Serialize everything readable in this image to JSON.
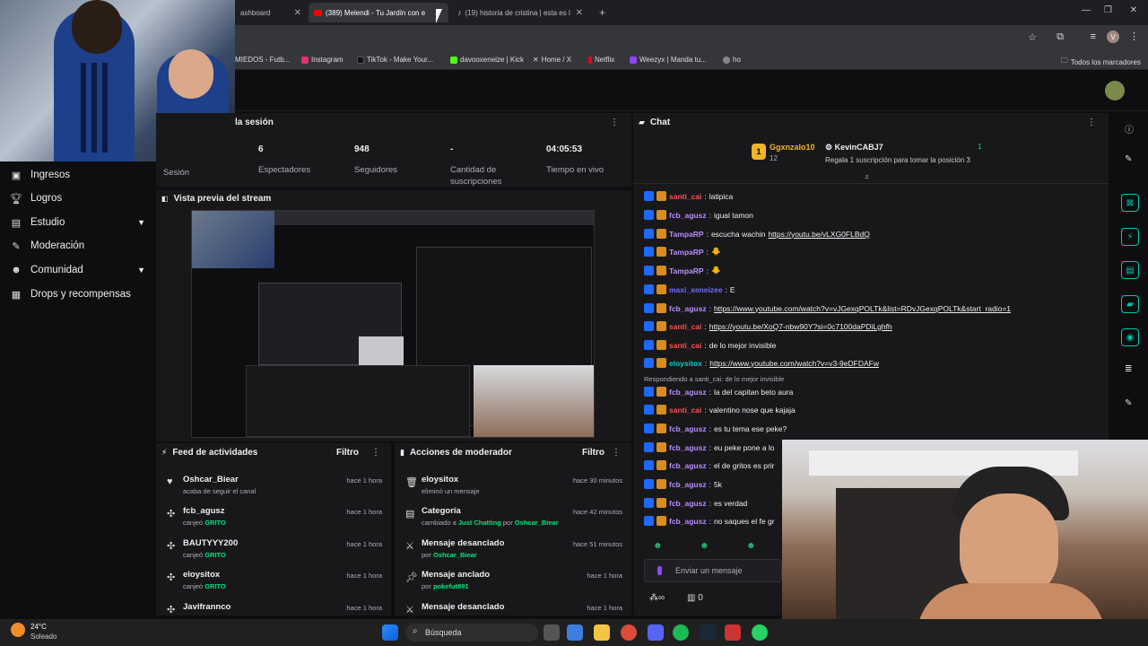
{
  "browser": {
    "tabs": [
      {
        "label": "ashboard",
        "active": false
      },
      {
        "label": "(389) Melendi - Tu Jardín con e",
        "active": true
      },
      {
        "label": "(19) historia de cristina | esta es l",
        "active": false
      }
    ],
    "new_tab": "+",
    "bookmarks": [
      {
        "label": "MIEDOS - Futb...",
        "icon_color": "#3f3f46"
      },
      {
        "label": "Instagram",
        "icon_color": "#e1306c"
      },
      {
        "label": "TikTok - Make Your...",
        "icon_color": "#000000"
      },
      {
        "label": "davooxeneize | Kick",
        "icon_color": "#53fc18"
      },
      {
        "label": "Home / X",
        "icon_color": "#000000"
      },
      {
        "label": "Netflix",
        "icon_color": "#e50914"
      },
      {
        "label": "Weezyx | Manda tu...",
        "icon_color": "#9146ff"
      },
      {
        "label": "ho",
        "icon_color": "#888888"
      }
    ],
    "all_bookmarks": "Todos los marcadores",
    "avatar_letter": "V"
  },
  "left_nav": {
    "items": [
      {
        "label": "Ingresos",
        "icon": "money-icon",
        "chevron": false
      },
      {
        "label": "Logros",
        "icon": "trophy-icon",
        "chevron": false
      },
      {
        "label": "Estudio",
        "icon": "studio-icon",
        "chevron": true
      },
      {
        "label": "Moderación",
        "icon": "wrench-icon",
        "chevron": false
      },
      {
        "label": "Comunidad",
        "icon": "community-icon",
        "chevron": true
      },
      {
        "label": "Drops y recompensas",
        "icon": "gift-icon",
        "chevron": false
      }
    ]
  },
  "session": {
    "title": "la sesión",
    "side_label": "Sesión",
    "stats": [
      {
        "value": "6",
        "label": "Espectadores"
      },
      {
        "value": "948",
        "label": "Seguidores"
      },
      {
        "value": "-",
        "label": "Cantidad de suscripciones"
      },
      {
        "value": "04:05:53",
        "label": "Tiempo en vivo"
      }
    ]
  },
  "preview": {
    "title": "Vista previa del stream"
  },
  "feed": {
    "title": "Feed de actividades",
    "filter": "Filtro",
    "items": [
      {
        "name": "Oshcar_Biear",
        "detail": "acaba de seguir el canal",
        "time": "hace 1 hora",
        "icon": "heart-icon"
      },
      {
        "name": "fcb_agusz",
        "detail": "canjeó",
        "reward": "GRITO",
        "time": "hace 1 hora",
        "icon": "points-icon"
      },
      {
        "name": "BAUTYYY200",
        "detail": "canjeó",
        "reward": "GRITO",
        "time": "hace 1 hora",
        "icon": "points-icon"
      },
      {
        "name": "eloysitox",
        "detail": "canjeó",
        "reward": "GRITO",
        "time": "hace 1 hora",
        "icon": "points-icon"
      },
      {
        "name": "Javifrannco",
        "detail": "",
        "time": "hace 1 hora",
        "icon": "points-icon"
      }
    ]
  },
  "mod_actions": {
    "title": "Acciones de moderador",
    "filter": "Filtro",
    "items": [
      {
        "name": "eloysitox",
        "detail": "eliminó un mensaje",
        "time": "hace 30 minutos",
        "icon": "trash-icon"
      },
      {
        "name": "Categoría",
        "detail": "cambiado a",
        "highlight": "Just Chatting",
        "detail2": "por",
        "by": "Oshcar_Biear",
        "time": "hace 42 minutos",
        "icon": "category-icon"
      },
      {
        "name": "Mensaje desanclado",
        "detail": "por",
        "by": "Oshcar_Biear",
        "time": "hace 51 minutos",
        "icon": "unpin-icon"
      },
      {
        "name": "Mensaje anclado",
        "detail": "por",
        "by": "pokefut891",
        "time": "hace 1 hora",
        "icon": "pin-icon"
      },
      {
        "name": "Mensaje desanclado",
        "detail": "",
        "time": "hace 1 hora",
        "icon": "unpin-icon"
      }
    ]
  },
  "chat": {
    "title": "Chat",
    "leaderboard": {
      "first_name": "Ggxnzalo10",
      "first_count": "12",
      "second_name": "KevinCABJ7",
      "second_rank": "1",
      "promo": "Regala 1 suscripción para tomar la posición 3"
    },
    "messages": [
      {
        "user": "santi_cai",
        "color": "#ff4f4f",
        "text": "latipica",
        "link": false
      },
      {
        "user": "fcb_agusz",
        "color": "#b88cff",
        "text": "igual tamon",
        "link": false
      },
      {
        "user": "TampaRP",
        "color": "#b88cff",
        "text": "escucha wachin",
        "url": "https://youtu.be/vLXG0FLBdQ"
      },
      {
        "user": "TampaRP",
        "color": "#b88cff",
        "text": "🐥"
      },
      {
        "user": "TampaRP",
        "color": "#b88cff",
        "text": "🐥"
      },
      {
        "user": "maxi_xeneizee",
        "color": "#6d6dff",
        "text": "E"
      },
      {
        "user": "fcb_agusz",
        "color": "#b88cff",
        "text": "",
        "url": "https://www.youtube.com/watch?v=vJGexqPOLTk&list=RDvJGexqPOLTk&start_radio=1"
      },
      {
        "user": "santi_cai",
        "color": "#ff4f4f",
        "text": "",
        "url": "https://youtu.be/XoQ7-nbw90Y?si=0c7100daPDiLghfh"
      },
      {
        "user": "santi_cai",
        "color": "#ff4f4f",
        "text": "de lo mejor invisible"
      },
      {
        "user": "eloysitox",
        "color": "#00d0c8",
        "text": "",
        "url": "https://www.youtube.com/watch?v=v3-9eDFDAFw"
      },
      {
        "user": "fcb_agusz",
        "color": "#b88cff",
        "text": "la del capitan beto aura",
        "reply": "Respondiendo a santi_cai: de lo mejor invisible"
      },
      {
        "user": "santi_cai",
        "color": "#ff4f4f",
        "text": "valentino nose que kajaja"
      },
      {
        "user": "fcb_agusz",
        "color": "#b88cff",
        "text": "es tu tema ese peke?"
      },
      {
        "user": "fcb_agusz",
        "color": "#b88cff",
        "text": "eu peke pone a lo"
      },
      {
        "user": "fcb_agusz",
        "color": "#b88cff",
        "text": "el de gritos es prir"
      },
      {
        "user": "fcb_agusz",
        "color": "#b88cff",
        "text": "5k"
      },
      {
        "user": "fcb_agusz",
        "color": "#b88cff",
        "text": "es verdad"
      },
      {
        "user": "fcb_agusz",
        "color": "#b88cff",
        "text": "no saques el fe gr"
      }
    ],
    "input_placeholder": "Enviar un mensaje",
    "points": "0"
  },
  "taskbar": {
    "weather_temp": "24°C",
    "weather_desc": "Soleado",
    "search": "Búsqueda"
  }
}
